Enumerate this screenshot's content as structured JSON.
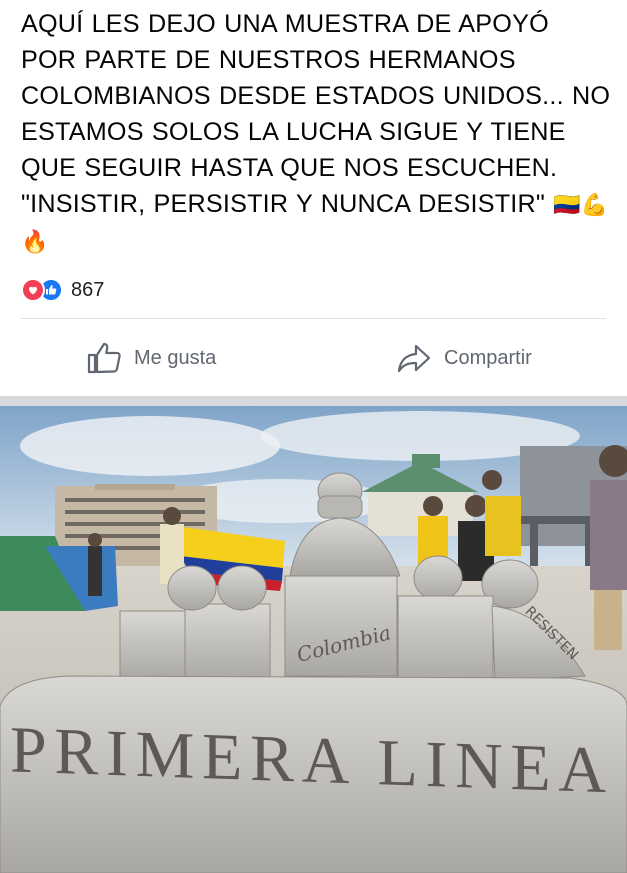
{
  "post": {
    "text": "AQUÍ  LES DEJO UNA MUESTRA DE APOYÓ POR PARTE DE NUESTROS HERMANOS COLOMBIANOS DESDE ESTADOS UNIDOS... NO ESTAMOS SOLOS LA LUCHA SIGUE Y TIENE QUE SEGUIR HASTA QUE NOS ESCUCHEN. \"INSISTIR, PERSISTIR Y NUNCA DESISTIR\"",
    "emojis": "🇨🇴💪🔥"
  },
  "reactions": {
    "icons": [
      "love-icon",
      "like-icon"
    ],
    "count": "867",
    "colors": {
      "love": "#f33e58",
      "like": "#1877f2"
    }
  },
  "actions": {
    "like_label": "Me gusta",
    "share_label": "Compartir"
  },
  "photo": {
    "sculpture_text_main": "PRIMERA LINEA",
    "sculpture_text_tablet": "Colombia",
    "sculpture_text_shield": "RESISTEN"
  }
}
